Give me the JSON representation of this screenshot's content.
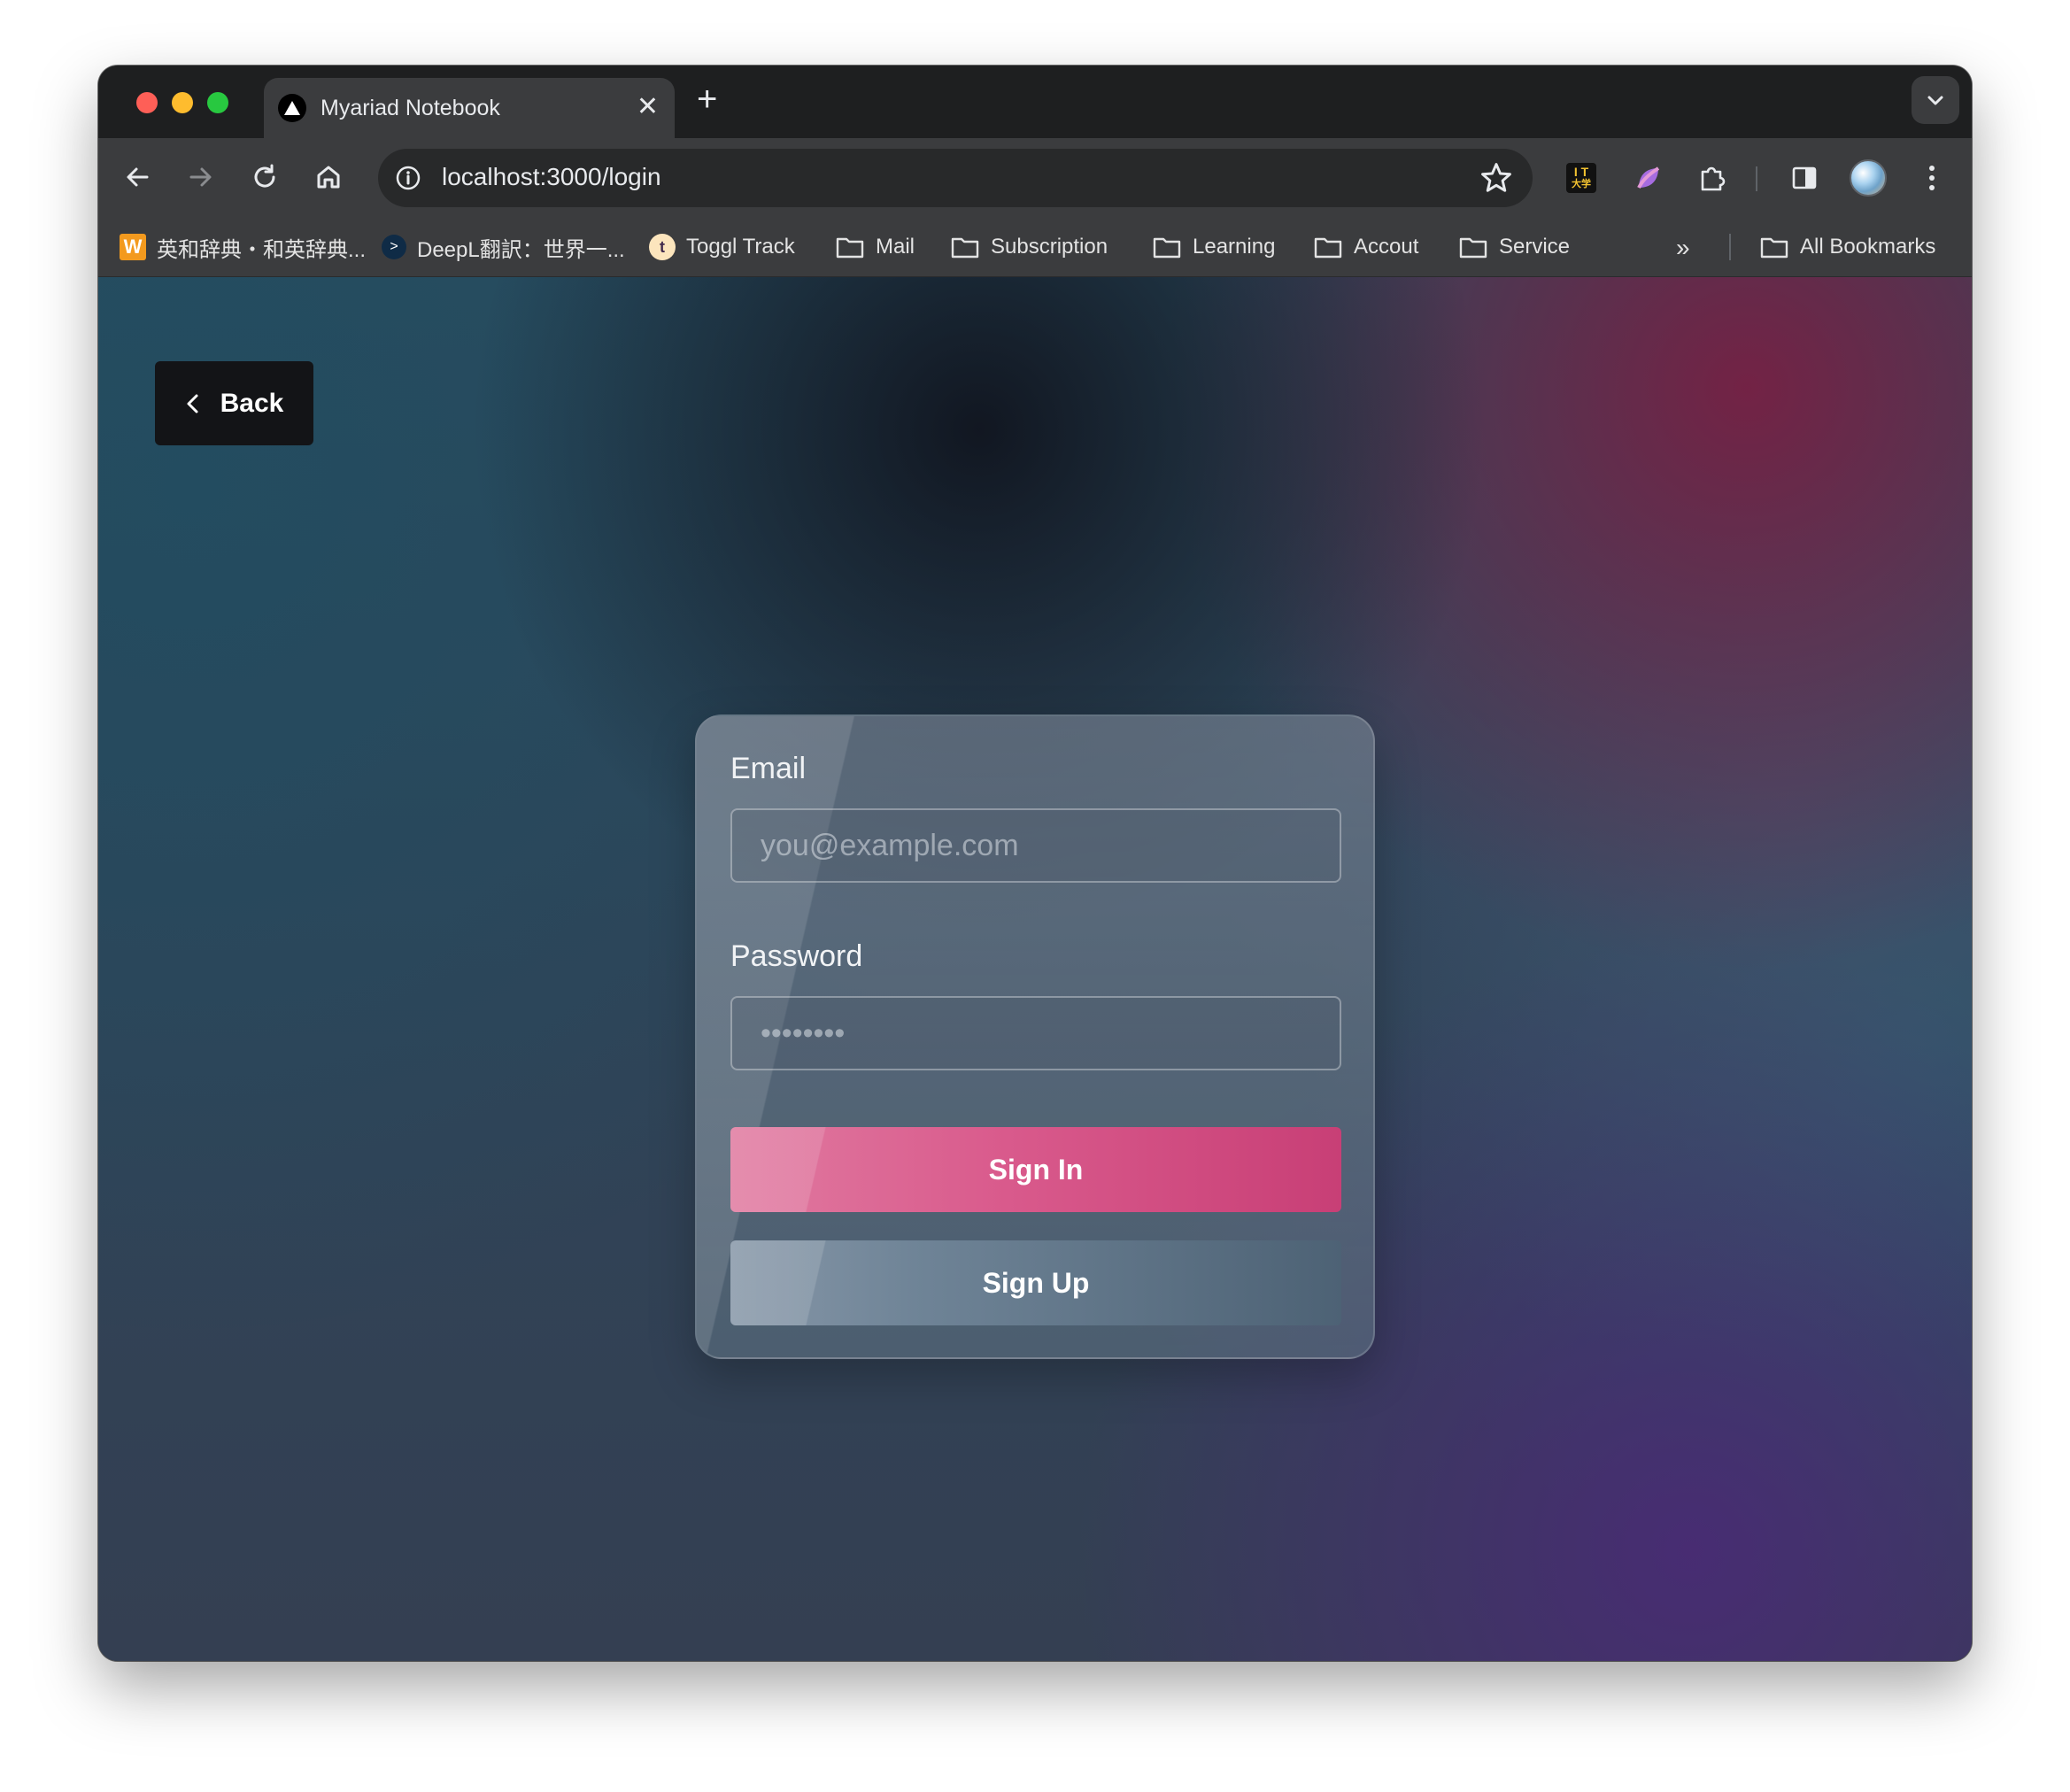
{
  "browser": {
    "tab": {
      "title": "Myariad Notebook",
      "close": "✕"
    },
    "new_tab": "+",
    "url": "localhost:3000/login",
    "bookmarks": [
      {
        "label": "英和辞典・和英辞典...",
        "icon": "weblio-icon"
      },
      {
        "label": "DeepL翻訳：世界一...",
        "icon": "deepl-icon"
      },
      {
        "label": "Toggl Track",
        "icon": "toggl-icon"
      },
      {
        "label": "Mail",
        "icon": "folder-icon"
      },
      {
        "label": "Subscription",
        "icon": "folder-icon"
      },
      {
        "label": "Learning",
        "icon": "folder-icon"
      },
      {
        "label": "Accout",
        "icon": "folder-icon"
      },
      {
        "label": "Service",
        "icon": "folder-icon"
      }
    ],
    "overflow": "»",
    "all_bookmarks": "All Bookmarks",
    "extensions": {
      "it_line1": "I T",
      "it_line2": "大学"
    }
  },
  "page": {
    "back_label": "Back",
    "form": {
      "email_label": "Email",
      "email_placeholder": "you@example.com",
      "email_value": "",
      "password_label": "Password",
      "password_placeholder": "••••••••",
      "password_value": "",
      "sign_in_label": "Sign In",
      "sign_up_label": "Sign Up"
    }
  },
  "colors": {
    "primary_button": "#d95a8c",
    "secondary_button": "#6f8497",
    "back_button": "#131417"
  }
}
